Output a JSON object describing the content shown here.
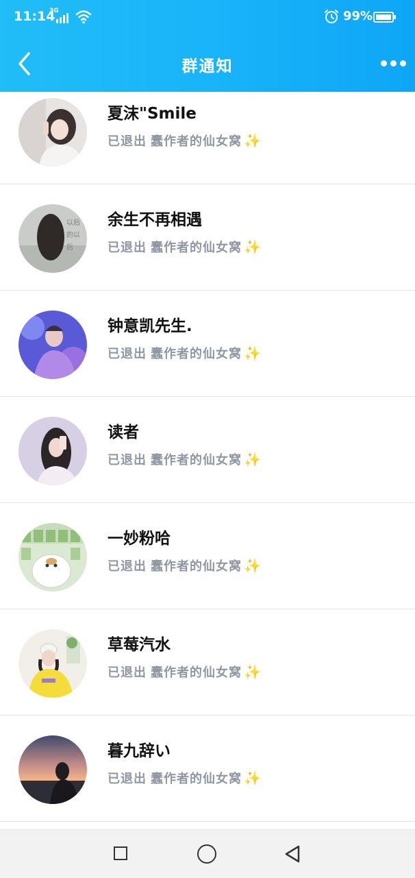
{
  "status_bar": {
    "time": "11:14",
    "network": "3G",
    "battery": "99%"
  },
  "nav": {
    "title": "群通知",
    "back_icon": "chevron-left-icon",
    "more_icon": "more-dots-icon"
  },
  "members": [
    {
      "name": "夏沫\"Smile",
      "action": "已退出",
      "group": "蠢作者的仙女窝",
      "emoji": "✨"
    },
    {
      "name": "余生不再相遇",
      "action": "已退出",
      "group": "蠢作者的仙女窝",
      "emoji": "✨"
    },
    {
      "name": "钟意凯先生.",
      "action": "已退出",
      "group": "蠢作者的仙女窝",
      "emoji": "✨"
    },
    {
      "name": "读者",
      "action": "已退出",
      "group": "蠢作者的仙女窝",
      "emoji": "✨"
    },
    {
      "name": "一妙粉哈",
      "action": "已退出",
      "group": "蠢作者的仙女窝",
      "emoji": "✨"
    },
    {
      "name": "草莓汽水",
      "action": "已退出",
      "group": "蠢作者的仙女窝",
      "emoji": "✨"
    },
    {
      "name": "暮九辞い",
      "action": "已退出",
      "group": "蠢作者的仙女窝",
      "emoji": "✨"
    }
  ],
  "bottom_nav": {
    "recents_icon": "square-icon",
    "home_icon": "circle-icon",
    "back_icon": "triangle-back-icon"
  }
}
